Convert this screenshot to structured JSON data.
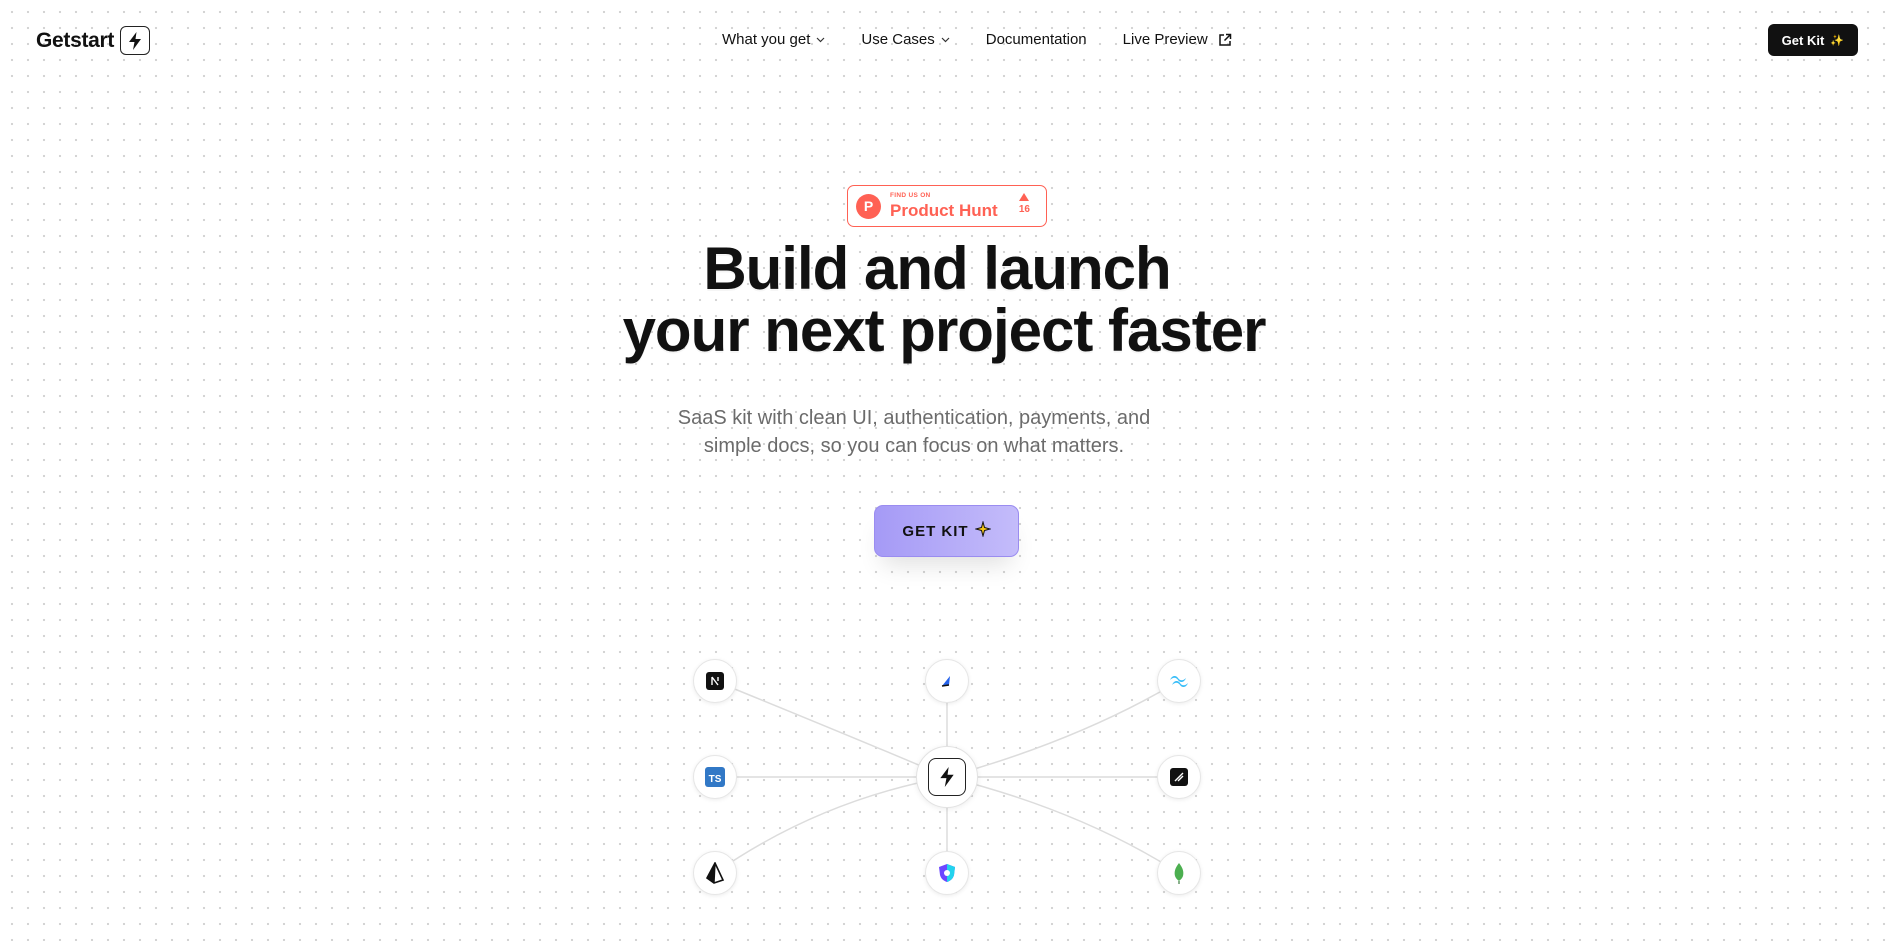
{
  "nav": {
    "logo_text": "Getstart",
    "menu": [
      {
        "label": "What you get",
        "has_dropdown": true
      },
      {
        "label": "Use Cases",
        "has_dropdown": true
      },
      {
        "label": "Documentation",
        "has_dropdown": false
      },
      {
        "label": "Live Preview",
        "has_dropdown": false,
        "icon": "external-link-icon"
      }
    ],
    "cta_label": "Get Kit",
    "cta_icon": "sparkle-icon"
  },
  "product_hunt": {
    "small_text": "FIND US ON",
    "title": "Product Hunt",
    "logo_letter": "P",
    "votes": "16",
    "color": "#ff6154"
  },
  "hero": {
    "title_line1": "Build and launch",
    "title_line2": "your next project faster",
    "subtitle_line1": "SaaS kit with clean UI, authentication, payments, and",
    "subtitle_line2": "simple docs, so you can focus on what matters.",
    "cta_label": "GET KIT",
    "cta_icon": "sparkle-icon",
    "cta_color": "#a59af6"
  },
  "integrations": {
    "center_icon": "lightning-logo-icon",
    "nodes": [
      {
        "icon": "nextjs-icon"
      },
      {
        "icon": "auth-js-icon"
      },
      {
        "icon": "tailwind-icon"
      },
      {
        "icon": "typescript-icon",
        "label": "TS"
      },
      {
        "icon": "shadcn-icon"
      },
      {
        "icon": "prisma-icon"
      },
      {
        "icon": "shield-auth-icon"
      },
      {
        "icon": "mongodb-icon"
      }
    ]
  }
}
